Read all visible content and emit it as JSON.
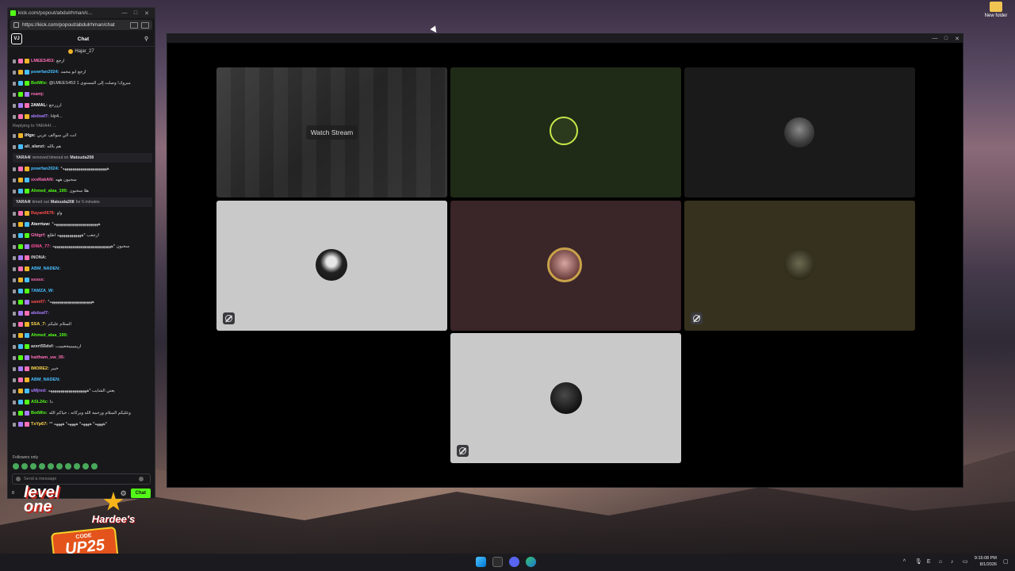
{
  "desktop": {
    "icon_label": "New folder"
  },
  "popout": {
    "title": "kick.com/popout/abdulrhman/c...",
    "url": "https://kick.com/popout/abdulrhman/chat",
    "header": "Chat",
    "pinned_user": "Hajar_27",
    "messages": [
      {
        "user": "LMEES453:",
        "text": "ارجع",
        "color": "#ff6fb5"
      },
      {
        "user": "powrfan2024:",
        "text": "ارجع ابو محمد",
        "color": "#48bfff"
      },
      {
        "user": "BotWix:",
        "text": "@LMEES453 مبروك! وصلت إلى المستوى 1",
        "color": "#53fc18"
      },
      {
        "user": "reamj:",
        "text": "",
        "color": "#ff6fb5"
      },
      {
        "user": "2AMAL:",
        "text": "ارررجع",
        "color": "#ffffff"
      },
      {
        "user": "abdoaf7:",
        "text": "Hp4...",
        "color": "#a97cff"
      },
      {
        "user": "iHgs:",
        "text": "انت الي سوالف عربي",
        "color": "#ffffff"
      },
      {
        "user": "ali_alanzi:",
        "text": "هم بالله",
        "color": "#d8d8d8"
      }
    ],
    "replying": "Replying to YARA4l: ...",
    "sys1": {
      "actor": "YARA4l",
      "mid": "removed timeout on",
      "target": "Matsuda208"
    },
    "messages2": [
      {
        "user": "powrfan2024:",
        "text": "*ههههههههههههههههههههههه",
        "color": "#48bfff"
      },
      {
        "user": "xxxRakAN:",
        "text": "سحبون ههه",
        "color": "#ff6fb5"
      },
      {
        "user": "Ahmed_alaa_190:",
        "text": "هلا سحبون",
        "color": "#53fc18"
      }
    ],
    "sys2": {
      "actor": "YARA4l",
      "mid": "timed out",
      "target": "Matsuda208",
      "tail": "for 5 minutes"
    },
    "messages3": [
      {
        "user": "Rayan0676:",
        "text": "واو",
        "color": "#ff4d4d"
      },
      {
        "user": "Aterrtuw:",
        "text": "*ههههههههههههههههههههههه",
        "color": "#ffffff"
      },
      {
        "user": "Gfdgrf:",
        "text": "ارجعب *ههههههههههههه اطلع",
        "color": "#ff6fb5"
      },
      {
        "user": "iDMA_77:",
        "text": "سحبون *هههههههههههههههههههههههههههههه",
        "color": "#ff4d9d"
      },
      {
        "user": "iNONA:",
        "text": "",
        "color": "#d8d8d8"
      },
      {
        "user": "ABM_NADEN:",
        "text": "",
        "color": "#48bfff"
      },
      {
        "user": "sssss:",
        "text": "",
        "color": "#ff6fb5"
      },
      {
        "user": "7AMZA_W:",
        "text": "",
        "color": "#48bfff"
      },
      {
        "user": "samif7:",
        "text": "*هههههههههههههههههههههه",
        "color": "#ff4d4d"
      },
      {
        "user": "abdoaf7:",
        "text": "",
        "color": "#a97cff"
      },
      {
        "user": "SSA_7:",
        "text": "السلام عليكم",
        "color": "#ffd84d"
      },
      {
        "user": "Ahmed_alaa_190:",
        "text": "",
        "color": "#53fc18"
      },
      {
        "user": "azert55dsf:",
        "text": "اريييييييجعيييب",
        "color": "#d8d8d8"
      },
      {
        "user": "haitham_uw_05:",
        "text": "",
        "color": "#ff6fb5"
      },
      {
        "user": "IMORE2:",
        "text": "خيبر",
        "color": "#ffd84d"
      },
      {
        "user": "ABM_NADEN:",
        "text": "",
        "color": "#48bfff"
      },
      {
        "user": "uMjred:",
        "text": "يعني الشايب *هههههههههههههههههههه",
        "color": "#a97cff"
      },
      {
        "user": "ASL24z:",
        "text": "دا",
        "color": "#53fc18"
      },
      {
        "user": "BotWix:",
        "text": "وعليكم السلام ورحمة الله وبركاته ، حياكم الله",
        "color": "#53fc18"
      },
      {
        "user": "TxYp67:",
        "text": "** ههههه* ههههه* ههههه* ههههه*",
        "color": "#ffd84d"
      }
    ],
    "followers_only": "Followers only",
    "send_placeholder": "Send a message",
    "points": "0",
    "chat_button": "Chat"
  },
  "promo": {
    "level_line1": "level",
    "level_line2": "one",
    "brand": "Hardee's",
    "code_label": "CODE",
    "code": "UP25"
  },
  "call": {
    "watch_label": "Watch Stream",
    "tiles": [
      {
        "id": "stream",
        "bg": "#2a2a2a"
      },
      {
        "id": "green",
        "bg": "#1f2b17"
      },
      {
        "id": "dark1",
        "bg": "#1a1a1a"
      },
      {
        "id": "grey1",
        "bg": "#c9c9c9"
      },
      {
        "id": "maroon",
        "bg": "#3a2529"
      },
      {
        "id": "olive",
        "bg": "#35311e"
      },
      {
        "id": "grey2",
        "bg": "#c9c9c9"
      }
    ]
  },
  "taskbar": {
    "time": "9:15:08 PM",
    "date": "8/1/2026"
  }
}
